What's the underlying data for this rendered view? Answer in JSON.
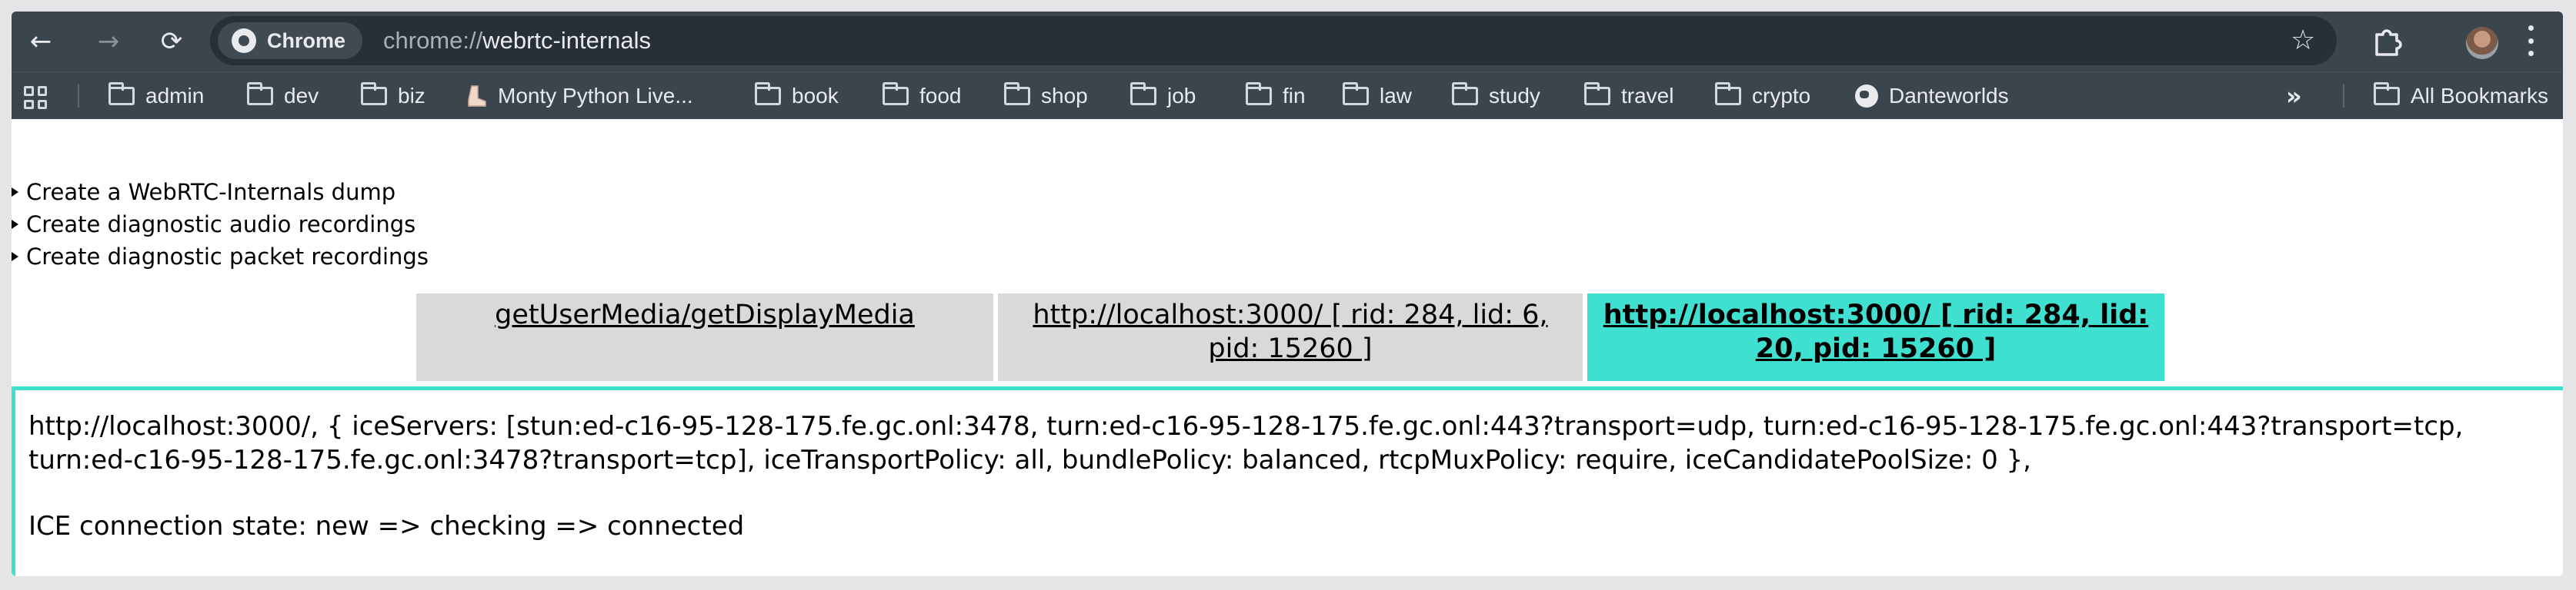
{
  "browser": {
    "chip_label": "Chrome",
    "url_scheme": "chrome://",
    "url_host": "webrtc-internals"
  },
  "bookmarks": {
    "items": [
      {
        "label": "admin",
        "icon": "folder-icon"
      },
      {
        "label": "dev",
        "icon": "folder-icon"
      },
      {
        "label": "biz",
        "icon": "folder-icon"
      },
      {
        "label": "Monty Python Live...",
        "icon": "boot-icon"
      },
      {
        "label": "book",
        "icon": "folder-icon"
      },
      {
        "label": "food",
        "icon": "folder-icon"
      },
      {
        "label": "shop",
        "icon": "folder-icon"
      },
      {
        "label": "job",
        "icon": "folder-icon"
      },
      {
        "label": "fin",
        "icon": "folder-icon"
      },
      {
        "label": "law",
        "icon": "folder-icon"
      },
      {
        "label": "study",
        "icon": "folder-icon"
      },
      {
        "label": "travel",
        "icon": "folder-icon"
      },
      {
        "label": "crypto",
        "icon": "folder-icon"
      },
      {
        "label": "Danteworlds",
        "icon": "globe-icon"
      }
    ],
    "overflow": "»",
    "all_bookmarks": "All Bookmarks"
  },
  "page": {
    "details": [
      "Create a WebRTC-Internals dump",
      "Create diagnostic audio recordings",
      "Create diagnostic packet recordings"
    ],
    "tabs": [
      {
        "label": "getUserMedia/getDisplayMedia",
        "active": false
      },
      {
        "label": "http://localhost:3000/ [ rid: 284, lid: 6, pid: 15260 ]",
        "active": false
      },
      {
        "label": "http://localhost:3000/ [ rid: 284, lid: 20, pid: 15260 ]",
        "active": true
      }
    ],
    "peer_connection_info": "http://localhost:3000/, { iceServers: [stun:ed-c16-95-128-175.fe.gc.onl:3478, turn:ed-c16-95-128-175.fe.gc.onl:443?transport=udp, turn:ed-c16-95-128-175.fe.gc.onl:443?transport=tcp, turn:ed-c16-95-128-175.fe.gc.onl:3478?transport=tcp], iceTransportPolicy: all, bundlePolicy: balanced, rtcpMuxPolicy: require, iceCandidatePoolSize: 0 },",
    "ice_state": "ICE connection state: new => checking => connected"
  },
  "colors": {
    "toolbar": "#3b454e",
    "active_tab": "#40e0d0",
    "inactive_tab": "#d9d9d9"
  }
}
